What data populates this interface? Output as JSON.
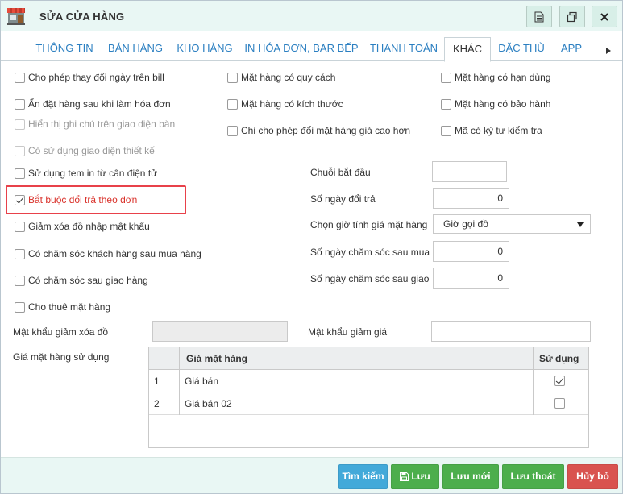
{
  "window": {
    "title": "SỬA CỬA HÀNG"
  },
  "colors": {
    "accent_blue": "#2b7fc1",
    "btn_search": "#42a9d9",
    "btn_green": "#4cae4c",
    "btn_red": "#d9534f",
    "highlight": "#e8414a"
  },
  "tabs": [
    {
      "label": "THÔNG TIN"
    },
    {
      "label": "BÁN HÀNG"
    },
    {
      "label": "KHO HÀNG"
    },
    {
      "label": "IN HÓA ĐƠN, BAR BẾP"
    },
    {
      "label": "THANH TOÁN"
    },
    {
      "label": "KHÁC"
    },
    {
      "label": "ĐẶC THÙ"
    },
    {
      "label": "APP"
    }
  ],
  "checkboxes": {
    "c1": "Cho phép thay đổi ngày trên bill",
    "c2": "Ẩn đặt hàng sau khi làm hóa đơn",
    "c3": "Hiển thị ghi chú trên giao diện bàn",
    "c4": "Có sử dụng giao diện thiết kế",
    "c5": "Sử dụng tem in từ cân điện tử",
    "c6": "Bắt buộc đổi trả theo đơn",
    "c7": "Giảm xóa đồ nhập mật khẩu",
    "c8": "Có chăm sóc khách hàng sau mua hàng",
    "c9": "Có chăm sóc sau giao hàng",
    "c10": "Cho thuê mặt hàng",
    "m1": "Mặt hàng có quy cách",
    "m2": "Mặt hàng có kích thước",
    "m3": "Chỉ cho phép đổi mặt hàng giá cao hơn",
    "r1": "Mặt hàng có hạn dùng",
    "r2": "Mặt hàng có bảo hành",
    "r3": "Mã có ký tự kiểm tra"
  },
  "fields": {
    "start_string_label": "Chuỗi bắt đầu",
    "start_string_value": "",
    "return_days_label": "Số ngày đổi trả",
    "return_days_value": "0",
    "price_time_label": "Chọn giờ tính giá mặt hàng",
    "price_time_value": "Giờ gọi đồ",
    "care_after_buy_label": "Số ngày chăm sóc sau mua",
    "care_after_buy_value": "0",
    "care_after_ship_label": "Số ngày chăm sóc sau giao",
    "care_after_ship_value": "0",
    "delete_password_label": "Mật khẩu giảm xóa đồ",
    "delete_password_value": "",
    "discount_password_label": "Mật khẩu giảm giá",
    "discount_password_value": ""
  },
  "price_table": {
    "label": "Giá mặt hàng sử dụng",
    "headers": {
      "name": "Giá mặt hàng",
      "used": "Sử dụng"
    },
    "rows": [
      {
        "no": "1",
        "name": "Giá bán",
        "used": true
      },
      {
        "no": "2",
        "name": "Giá bán 02",
        "used": false
      }
    ]
  },
  "footer": {
    "search": "Tìm kiếm",
    "save": "Lưu",
    "save_new": "Lưu mới",
    "save_exit": "Lưu thoát",
    "cancel": "Hủy bỏ"
  }
}
